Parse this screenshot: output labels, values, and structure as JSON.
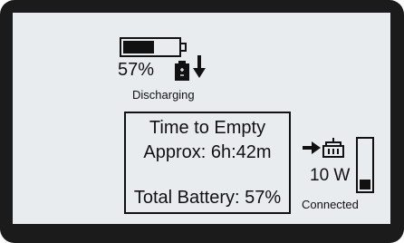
{
  "battery": {
    "percent_label": "57%",
    "charge_level": 0.57,
    "status": "Discharging",
    "direction": "down-arrow"
  },
  "info": {
    "title": "Time to Empty",
    "approx": "Approx: 6h:42m",
    "total": "Total Battery: 57%"
  },
  "power": {
    "watts": "10 W",
    "connection": "Connected",
    "load_level": 0.2,
    "icons": [
      "right-arrow-icon",
      "power-outlet-icon"
    ]
  },
  "colors": {
    "frame": "#1b1b1b",
    "screen": "#e8ecef",
    "ink": "#111111"
  }
}
